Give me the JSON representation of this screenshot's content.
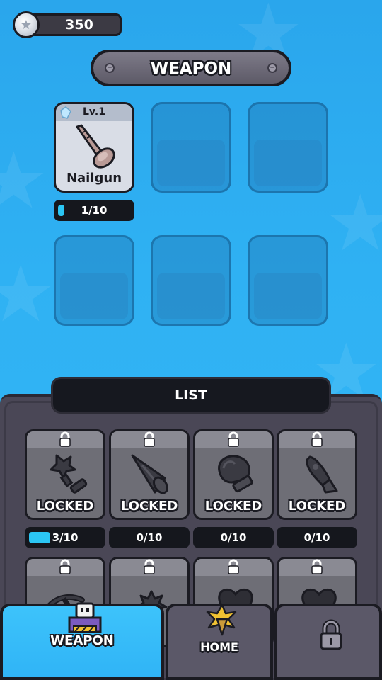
{
  "currency": {
    "value": "350"
  },
  "banner": {
    "title": "WEAPON"
  },
  "equipped": {
    "level": "Lv.1",
    "name": "Nailgun",
    "progress_text": "1/10",
    "progress": 0.1
  },
  "list": {
    "title": "LIST",
    "items": [
      {
        "label": "LOCKED",
        "icon": "plunger-icon",
        "progress_text": "3/10",
        "progress": 0.3
      },
      {
        "label": "LOCKED",
        "icon": "drill-cone-icon",
        "progress_text": "0/10",
        "progress": 0
      },
      {
        "label": "LOCKED",
        "icon": "boxing-glove-icon",
        "progress_text": "0/10",
        "progress": 0
      },
      {
        "label": "LOCKED",
        "icon": "rocket-icon",
        "progress_text": "0/10",
        "progress": 0
      }
    ],
    "second_row_icons": [
      "pickaxe-icon",
      "spiked-ball-icon",
      "heart-icon",
      "heart-icon"
    ]
  },
  "nav": {
    "weapon_label": "WEAPON",
    "home_label": "HOME"
  },
  "colors": {
    "background": "#2fb1f3",
    "panel": "#4a4756",
    "progress_fill": "#2bc6f4"
  }
}
